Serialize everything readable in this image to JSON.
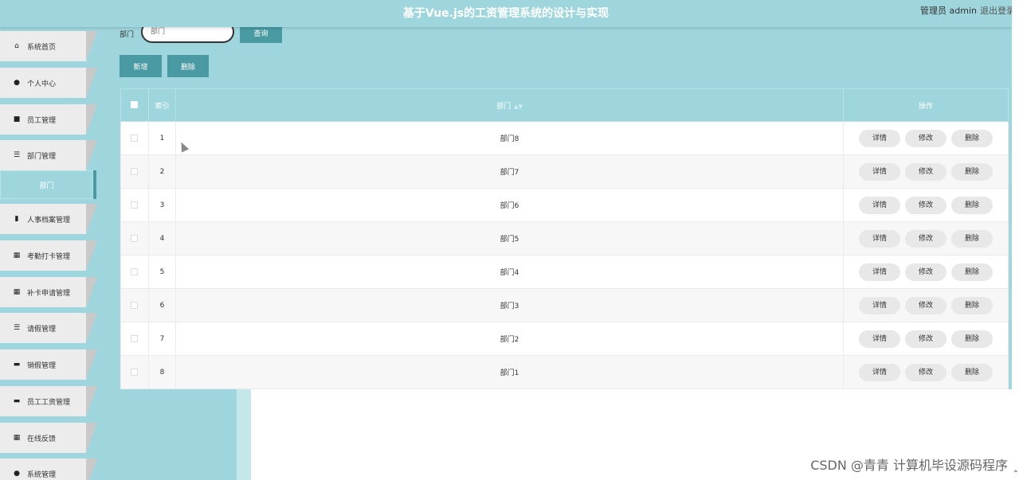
{
  "header": {
    "title": "基于Vue.js的工资管理系统的设计与实现",
    "user": "管理员 admin",
    "logout": "退出登录"
  },
  "sidebar": {
    "items": [
      {
        "icon": "home-icon",
        "glyph": "⌂",
        "label": "系统首页"
      },
      {
        "icon": "user-icon",
        "glyph": "●",
        "label": "个人中心"
      },
      {
        "icon": "briefcase-icon",
        "glyph": "■",
        "label": "员工管理"
      },
      {
        "icon": "list-icon",
        "glyph": "☰",
        "label": "部门管理"
      },
      {
        "icon": "book-icon",
        "glyph": "▮",
        "label": "人事档案管理"
      },
      {
        "icon": "grid-icon",
        "glyph": "▦",
        "label": "考勤打卡管理"
      },
      {
        "icon": "grid-icon",
        "glyph": "▦",
        "label": "补卡申请管理"
      },
      {
        "icon": "list-icon",
        "glyph": "☰",
        "label": "请假管理"
      },
      {
        "icon": "monitor-icon",
        "glyph": "▬",
        "label": "销假管理"
      },
      {
        "icon": "card-icon",
        "glyph": "▬",
        "label": "员工工资管理"
      },
      {
        "icon": "grid-icon",
        "glyph": "▦",
        "label": "在线反馈"
      },
      {
        "icon": "pin-icon",
        "glyph": "●",
        "label": "系统管理"
      }
    ],
    "active_sub": "部门"
  },
  "search": {
    "label": "部门",
    "placeholder": "部门",
    "query_button": "查询"
  },
  "toolbar": {
    "add": "新增",
    "delete": "删除"
  },
  "table": {
    "headers": {
      "index": "索引",
      "name": "部门",
      "ops": "操作"
    },
    "rows": [
      {
        "index": "1",
        "name": "部门8"
      },
      {
        "index": "2",
        "name": "部门7"
      },
      {
        "index": "3",
        "name": "部门6"
      },
      {
        "index": "4",
        "name": "部门5"
      },
      {
        "index": "5",
        "name": "部门4"
      },
      {
        "index": "6",
        "name": "部门3"
      },
      {
        "index": "7",
        "name": "部门2"
      },
      {
        "index": "8",
        "name": "部门1"
      }
    ],
    "ops": {
      "detail": "详情",
      "edit": "修改",
      "delete": "删除"
    }
  },
  "watermark": "CSDN @青青  计算机毕设源码程序"
}
